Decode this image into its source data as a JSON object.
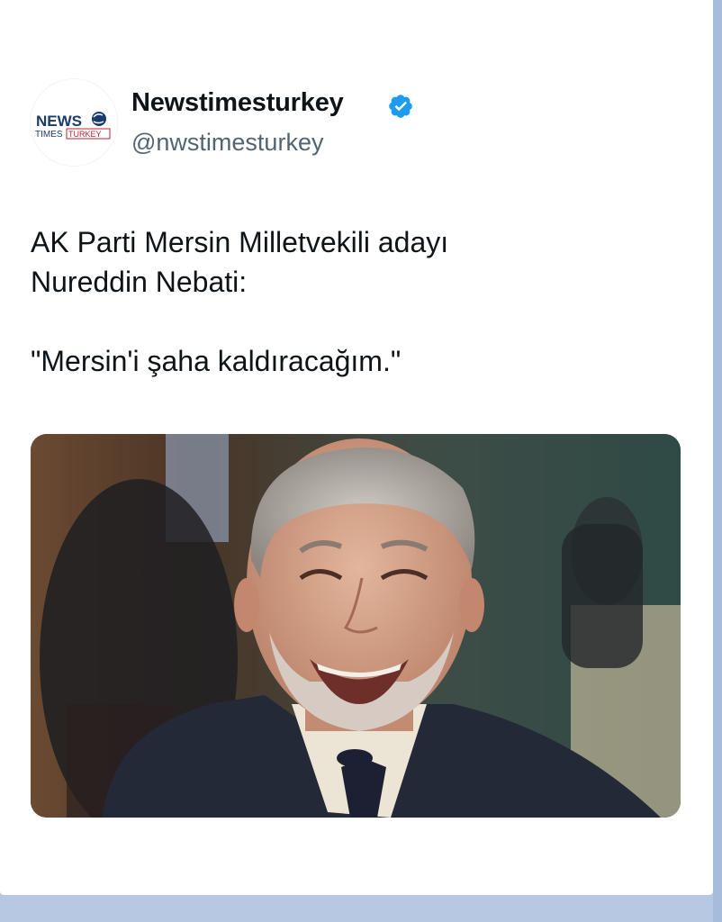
{
  "account": {
    "display_name": "Newstimesturkey",
    "handle": "@nwstimesturkey",
    "verified": true,
    "avatar_icon": "newstimesturkey-logo-icon",
    "avatar_logo_lines": [
      "NEWS",
      "TIMES",
      "TURKEY"
    ]
  },
  "tweet": {
    "line1": "AK Parti Mersin Milletvekili adayı",
    "line2": "Nureddin Nebati:",
    "quote": "\"Mersin'i şaha kaldıracağım.\""
  },
  "media": {
    "description_icon": "smiling-man-photo"
  },
  "colors": {
    "text_primary": "#0f1419",
    "text_secondary": "#536471",
    "verified_blue": "#1d9bf0",
    "page_background": "#b7c8e3"
  }
}
